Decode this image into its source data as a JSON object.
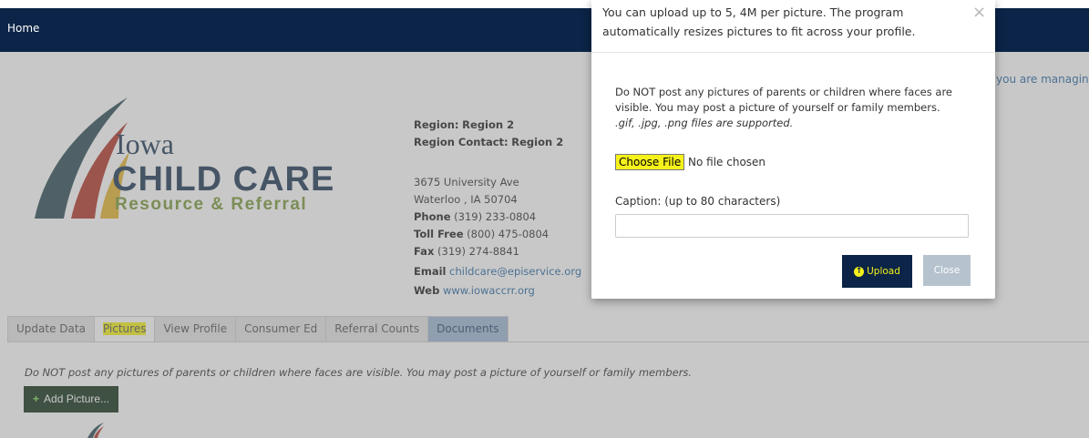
{
  "header": {
    "nav_home": "Home"
  },
  "managing_text": "you are managing",
  "logo": {
    "line1": "Iowa",
    "line2": "CHILD CARE",
    "line3": "Resource & Referral"
  },
  "region": {
    "region_label": "Region:",
    "region_value": "Region 2",
    "contact_label": "Region Contact:",
    "contact_value": "Region 2",
    "address1": "3675 University Ave",
    "address2": "Waterloo , IA 50704",
    "phone_label": "Phone",
    "phone_value": "(319) 233-0804",
    "tollfree_label": "Toll Free",
    "tollfree_value": "(800) 475-0804",
    "fax_label": "Fax",
    "fax_value": "(319) 274-8841",
    "email_label": "Email",
    "email_value": "childcare@episervice.org",
    "web_label": "Web",
    "web_value": "www.iowaccrr.org"
  },
  "tabs": [
    {
      "label": "Update Data"
    },
    {
      "label": "Pictures"
    },
    {
      "label": "View Profile"
    },
    {
      "label": "Consumer Ed"
    },
    {
      "label": "Referral Counts"
    },
    {
      "label": "Documents"
    }
  ],
  "main": {
    "notice": "Do NOT post any pictures of parents or children where faces are visible. You may post a picture of yourself or family members.",
    "add_button": "Add Picture..."
  },
  "modal": {
    "header_text": "You can upload up to 5, 4M per picture. The program automatically resizes pictures to fit across your profile.",
    "close_x": "×",
    "body_text": "Do NOT post any pictures of parents or children where faces are visible. You may post a picture of yourself or family members.",
    "formats_text": ".gif, .jpg, .png files are supported.",
    "choose_file_label": "Choose File",
    "no_file_text": "No file chosen",
    "caption_label": "Caption: (up to 80 characters)",
    "caption_value": "",
    "upload_label": "Upload",
    "close_label": "Close"
  },
  "colors": {
    "nav_bg": "#0b2447",
    "highlight": "#f5f11a",
    "add_button_bg": "#14321a",
    "link": "#2a6aa6"
  }
}
